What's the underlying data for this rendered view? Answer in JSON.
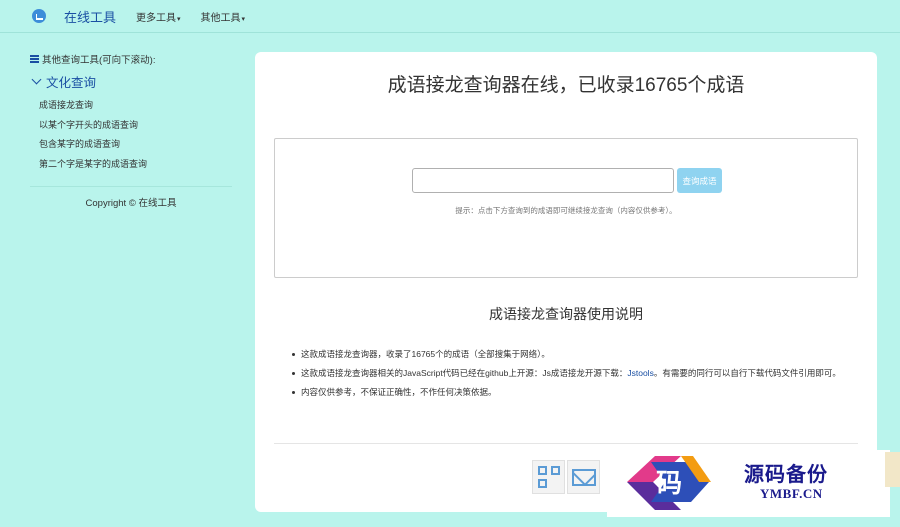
{
  "navbar": {
    "brand": "在线工具",
    "menu": [
      {
        "label": "更多工具",
        "caret": "▾"
      },
      {
        "label": "其他工具",
        "caret": "▾"
      }
    ]
  },
  "sidebar": {
    "heading": "其他查询工具(可向下滚动):",
    "category": "文化查询",
    "links": [
      "成语接龙查询",
      "以某个字开头的成语查询",
      "包含某字的成语查询",
      "第二个字是某字的成语查询"
    ],
    "copyright": "Copyright © 在线工具"
  },
  "main": {
    "title": "成语接龙查询器在线，已收录16765个成语",
    "search": {
      "placeholder": "",
      "value": "",
      "button": "查询成语"
    },
    "hint": "提示：点击下方查询到的成语即可继续接龙查询（内容仅供参考）。",
    "subtitle": "成语接龙查询器使用说明",
    "notes": [
      {
        "text": "这款成语接龙查询器，收录了16765个的成语（全部搜集于网络）。"
      },
      {
        "text_before": "这款成语接龙查询器相关的JavaScript代码已经在github上开源：Js成语接龙开源下载：",
        "link": "Jstools",
        "text_after": "。有需要的同行可以自行下载代码文件引用即可。"
      },
      {
        "text": "内容仅供参考，不保证正确性，不作任何决策依据。"
      }
    ],
    "share_icons": [
      "qr-code-icon",
      "mail-icon"
    ]
  },
  "watermark": {
    "cn": "源码备份",
    "en": "YMBF.CN",
    "glyph": "码"
  },
  "colors": {
    "background": "#b9f4ec",
    "brand": "#1a4fa3",
    "button": "#8fd3f0"
  }
}
